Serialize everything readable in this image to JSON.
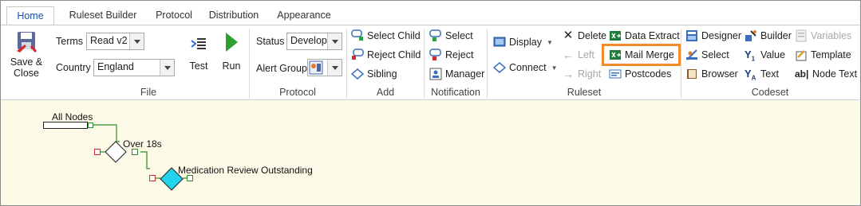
{
  "tabs": [
    {
      "label": "Home",
      "active": true
    },
    {
      "label": "Ruleset Builder"
    },
    {
      "label": "Protocol"
    },
    {
      "label": "Distribution"
    },
    {
      "label": "Appearance"
    }
  ],
  "file": {
    "save_close_line1": "Save &",
    "save_close_line2": "Close",
    "terms_label": "Terms",
    "terms_value": "Read v2",
    "country_label": "Country",
    "country_value": "England",
    "test_label": "Test",
    "run_label": "Run",
    "group_label": "File"
  },
  "protocol": {
    "status_label": "Status",
    "status_value": "Develop",
    "alert_group_label": "Alert Group",
    "group_label": "Protocol"
  },
  "add": {
    "select_child": "Select Child",
    "reject_child": "Reject Child",
    "sibling": "Sibling",
    "group_label": "Add"
  },
  "notification": {
    "select": "Select",
    "reject": "Reject",
    "manager": "Manager",
    "group_label": "Notification"
  },
  "ruleset": {
    "display": "Display",
    "connect": "Connect",
    "delete": "Delete",
    "left": "Left",
    "right": "Right",
    "data_extract": "Data Extract",
    "mail_merge": "Mail Merge",
    "postcodes": "Postcodes",
    "group_label": "Ruleset"
  },
  "codeset": {
    "designer": "Designer",
    "select": "Select",
    "browser": "Browser",
    "builder": "Builder",
    "value": "Value",
    "text": "Text",
    "variables": "Variables",
    "template": "Template",
    "node_text": "Node Text",
    "group_label": "Codeset"
  },
  "tree": {
    "root": "All Nodes",
    "node1": "Over 18s",
    "node2": "Medication Review Outstanding"
  },
  "colors": {
    "canvas_bg": "#fdfae7",
    "highlight": "#f08c2b",
    "connector": "#2e8b2e",
    "node_active": "#22d3ee"
  }
}
